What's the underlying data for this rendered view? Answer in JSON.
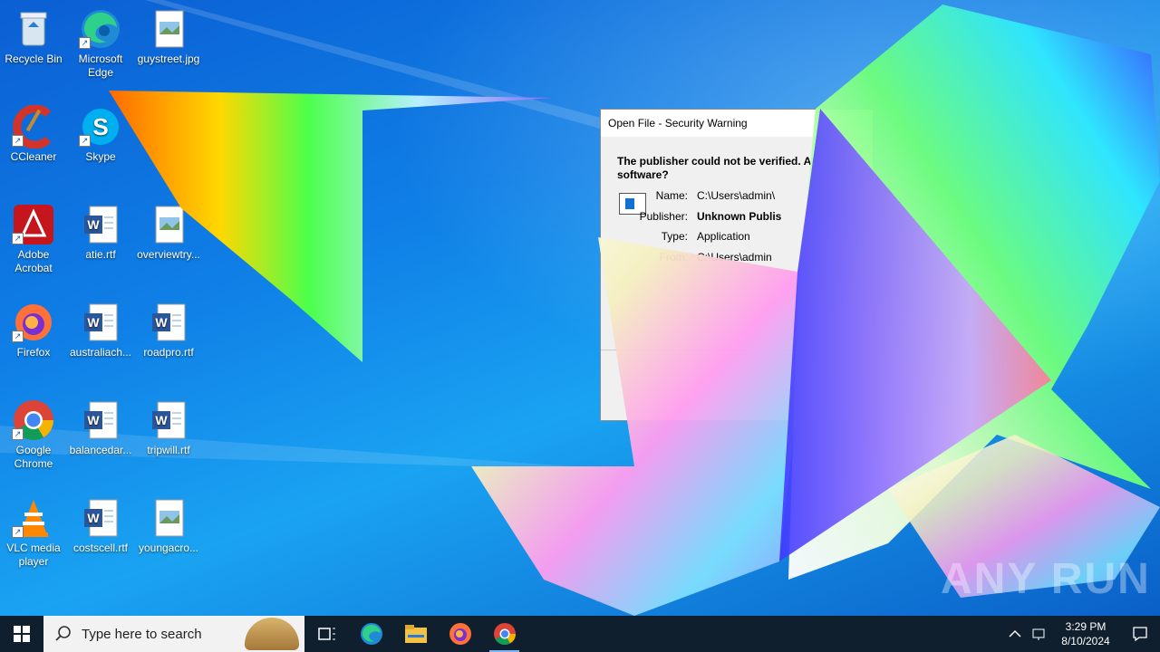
{
  "desktop": {
    "icons": [
      {
        "label": "Recycle Bin",
        "icon": "recycle-bin-icon"
      },
      {
        "label": "Microsoft Edge",
        "icon": "edge-icon"
      },
      {
        "label": "guystreet.jpg",
        "icon": "image-file-icon"
      },
      {
        "label": "CCleaner",
        "icon": "ccleaner-icon"
      },
      {
        "label": "Skype",
        "icon": "skype-icon"
      },
      {
        "label": "Adobe Acrobat",
        "icon": "acrobat-icon"
      },
      {
        "label": "atie.rtf",
        "icon": "word-doc-icon"
      },
      {
        "label": "overviewtry...",
        "icon": "image-file-icon"
      },
      {
        "label": "Firefox",
        "icon": "firefox-icon"
      },
      {
        "label": "australiach...",
        "icon": "word-doc-icon"
      },
      {
        "label": "roadpro.rtf",
        "icon": "word-doc-icon"
      },
      {
        "label": "Google Chrome",
        "icon": "chrome-icon"
      },
      {
        "label": "balancedar...",
        "icon": "word-doc-icon"
      },
      {
        "label": "tripwill.rtf",
        "icon": "word-doc-icon"
      },
      {
        "label": "VLC media player",
        "icon": "vlc-icon"
      },
      {
        "label": "costscell.rtf",
        "icon": "word-doc-icon"
      },
      {
        "label": "youngacro...",
        "icon": "image-file-icon"
      }
    ]
  },
  "dialog": {
    "title": "Open File - Security Warning",
    "warning": "The publisher could not be verified.  Are",
    "warning_line2": "software?",
    "name_label": "Name:",
    "name_value": "C:\\Users\\admin\\",
    "publisher_label": "Publisher:",
    "publisher_value": "Unknown Publis",
    "type_label": "Type:",
    "type_value": "Application",
    "from_label": "From:",
    "from_value": "C:\\Users\\admin"
  },
  "watermark": "ANY RUN",
  "taskbar": {
    "search_placeholder": "Type here to search",
    "time": "3:29 PM",
    "date": "8/10/2024"
  }
}
